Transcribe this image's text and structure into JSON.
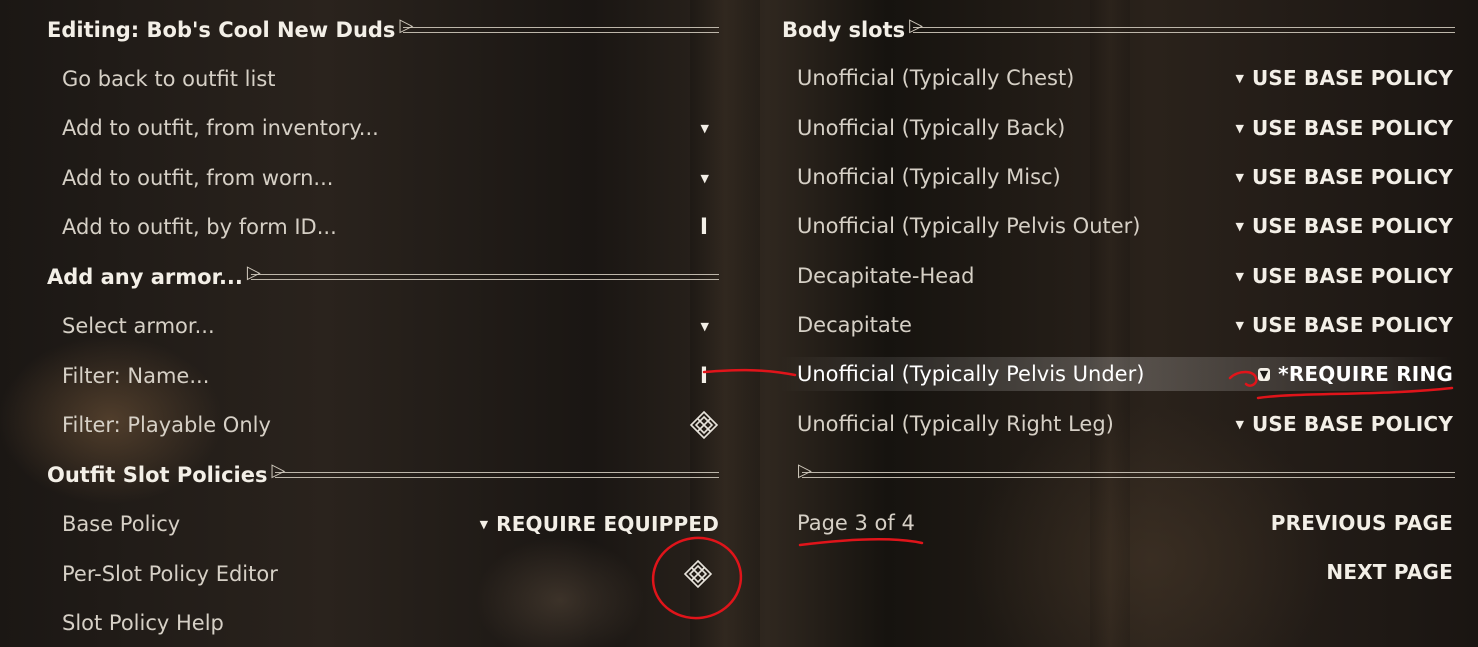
{
  "left": {
    "sections": [
      {
        "header": "Editing: Bob's Cool New Duds",
        "items": [
          {
            "label": "Go back to outfit list",
            "control": "none"
          },
          {
            "label": "Add to outfit, from inventory...",
            "control": "menu"
          },
          {
            "label": "Add to outfit, from worn...",
            "control": "menu"
          },
          {
            "label": "Add to outfit, by form ID...",
            "control": "text",
            "glyph": "I"
          }
        ]
      },
      {
        "header": "Add any armor...",
        "items": [
          {
            "label": "Select armor...",
            "control": "menu"
          },
          {
            "label": "Filter: Name...",
            "control": "text",
            "glyph": "I"
          },
          {
            "label": "Filter: Playable Only",
            "control": "toggle"
          }
        ]
      },
      {
        "header": "Outfit Slot Policies",
        "items": [
          {
            "label": "Base Policy",
            "control": "menu",
            "value": "REQUIRE EQUIPPED"
          },
          {
            "label": "Per-Slot Policy Editor",
            "control": "toggle"
          },
          {
            "label": "Slot Policy Help",
            "control": "none"
          }
        ]
      }
    ]
  },
  "right": {
    "header": "Body slots",
    "slots": [
      {
        "label": "Unofficial (Typically Chest)",
        "value": "USE BASE POLICY"
      },
      {
        "label": "Unofficial (Typically Back)",
        "value": "USE BASE POLICY"
      },
      {
        "label": "Unofficial (Typically Misc)",
        "value": "USE BASE POLICY"
      },
      {
        "label": "Unofficial (Typically Pelvis Outer)",
        "value": "USE BASE POLICY"
      },
      {
        "label": "Decapitate-Head",
        "value": "USE BASE POLICY"
      },
      {
        "label": "Decapitate",
        "value": "USE BASE POLICY"
      },
      {
        "label": "Unofficial (Typically Pelvis Under)",
        "value": "*REQUIRE RING",
        "highlighted": true
      },
      {
        "label": "Unofficial (Typically Right Leg)",
        "value": "USE BASE POLICY"
      }
    ],
    "page_indicator": "Page 3 of 4",
    "prev_page": "PREVIOUS PAGE",
    "next_page": "NEXT PAGE"
  },
  "icons": {
    "menu": "triangle-down-icon",
    "text": "text-cursor-icon",
    "toggle": "diamond-toggle-icon"
  },
  "annotation_color": "#e0141a"
}
